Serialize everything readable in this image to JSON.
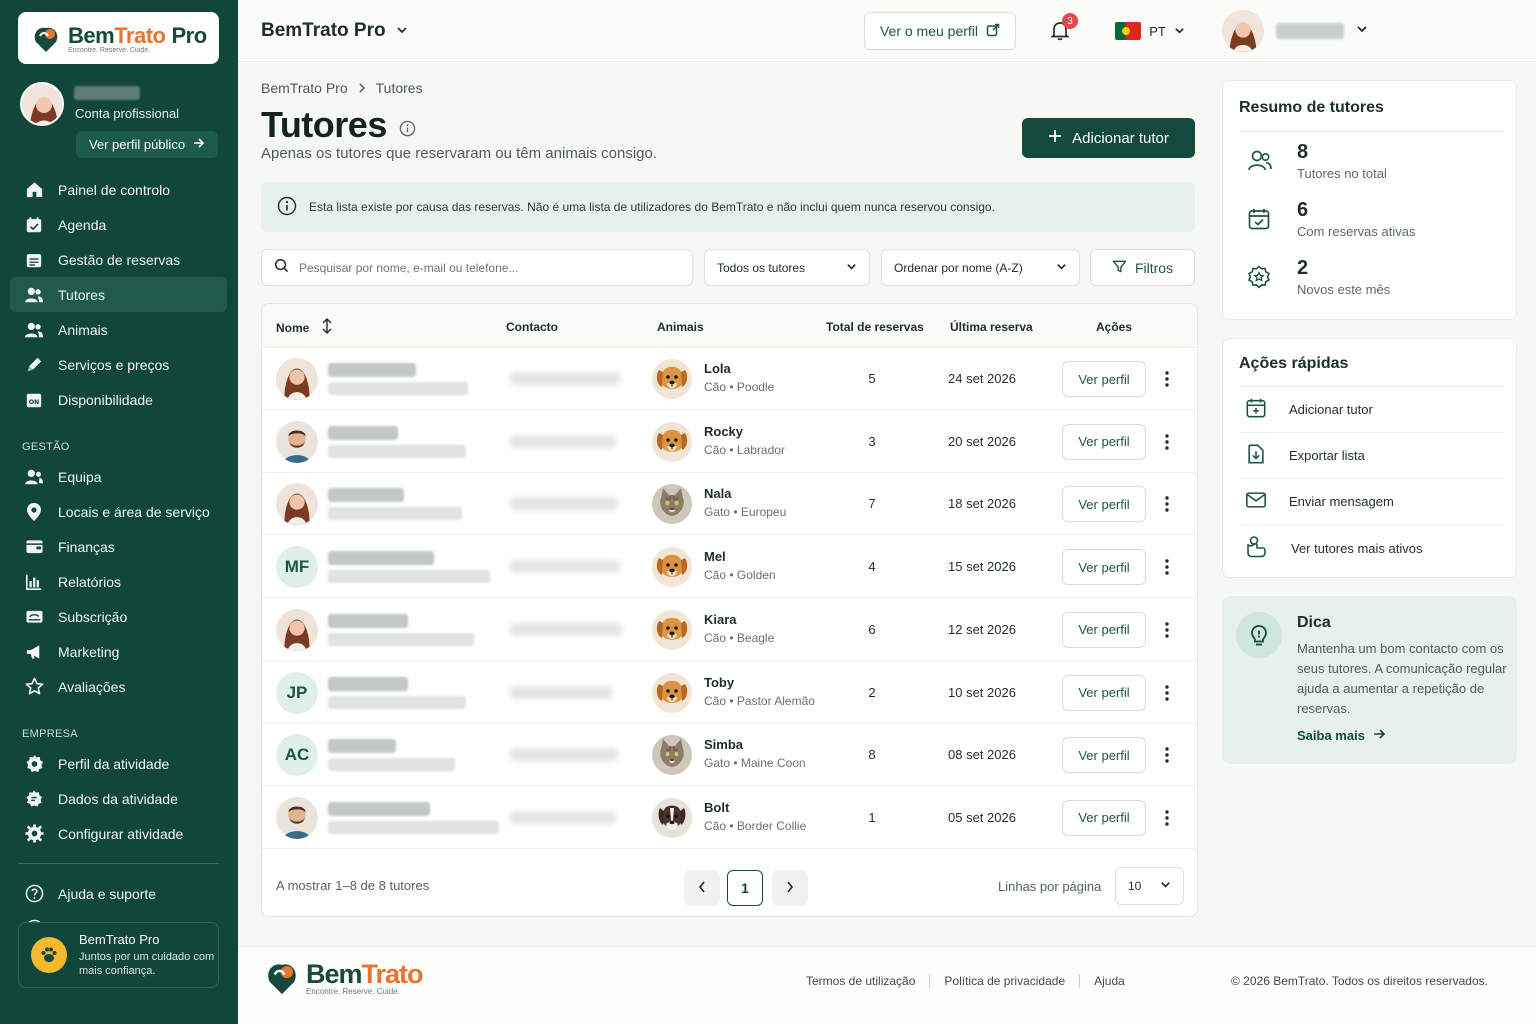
{
  "brand": {
    "name_part1": "Bem",
    "name_part2": "Trato",
    "suffix": "Pro",
    "tagline": "Encontre. Reserve. Cuide."
  },
  "sidebar": {
    "profile": {
      "role": "Conta profissional",
      "public_profile_label": "Ver perfil público"
    },
    "main_items": [
      {
        "label": "Painel de controlo",
        "icon": "home-icon"
      },
      {
        "label": "Agenda",
        "icon": "calendar-icon"
      },
      {
        "label": "Gestão de reservas",
        "icon": "calendar-list-icon"
      },
      {
        "label": "Tutores",
        "icon": "users-icon",
        "active": true
      },
      {
        "label": "Animais",
        "icon": "paw-users-icon"
      },
      {
        "label": "Serviços e preços",
        "icon": "tag-icon"
      },
      {
        "label": "Disponibilidade",
        "icon": "availability-icon"
      }
    ],
    "section_gestao": "GESTÃO",
    "gestao_items": [
      {
        "label": "Equipa",
        "icon": "team-icon"
      },
      {
        "label": "Locais e área de serviço",
        "icon": "location-icon"
      },
      {
        "label": "Finanças",
        "icon": "wallet-icon"
      },
      {
        "label": "Relatórios",
        "icon": "bar-chart-icon"
      },
      {
        "label": "Subscrição",
        "icon": "subscription-icon"
      },
      {
        "label": "Marketing",
        "icon": "megaphone-icon"
      },
      {
        "label": "Avaliações",
        "icon": "star-icon"
      }
    ],
    "section_empresa": "EMPRESA",
    "empresa_items": [
      {
        "label": "Perfil da atividade",
        "icon": "gear-badge-icon"
      },
      {
        "label": "Dados da atividade",
        "icon": "document-icon"
      },
      {
        "label": "Configurar atividade",
        "icon": "gear-icon"
      }
    ],
    "bottom_items": [
      {
        "label": "Ajuda e suporte",
        "icon": "help-icon"
      },
      {
        "label": "Conta",
        "icon": "account-icon"
      }
    ],
    "promo": {
      "title": "BemTrato Pro",
      "subtitle": "Juntos por um cuidado com mais confiança."
    }
  },
  "topbar": {
    "title": "BemTrato Pro",
    "profile_button": "Ver o meu perfil",
    "notifications_count": "3",
    "language": "PT"
  },
  "page": {
    "breadcrumb": [
      "BemTrato Pro",
      "Tutores"
    ],
    "title": "Tutores",
    "subtitle": "Apenas os tutores que reservaram ou têm animais consigo.",
    "add_button": "Adicionar tutor",
    "info": "Esta lista existe por causa das reservas. Não é uma lista de utilizadores do BemTrato e não inclui quem nunca reservou consigo.",
    "search_placeholder": "Pesquisar por nome, e-mail ou telefone...",
    "filter_select": "Todos os tutores",
    "sort_select": "Ordenar por nome (A-Z)",
    "filters_button": "Filtros"
  },
  "table": {
    "columns": {
      "name": "Nome",
      "contact": "Contacto",
      "animals": "Animais",
      "total": "Total de reservas",
      "last": "Última reserva",
      "actions": "Ações"
    },
    "view_label": "Ver perfil",
    "rows": [
      {
        "avatar": "photo-woman",
        "initials": "",
        "pet": "Lola",
        "species": "Cão",
        "breed": "Poodle",
        "pet_type": "dog",
        "total": "5",
        "last": "24 set 2026"
      },
      {
        "avatar": "photo-man",
        "initials": "",
        "pet": "Rocky",
        "species": "Cão",
        "breed": "Labrador",
        "pet_type": "dog",
        "total": "3",
        "last": "20 set 2026"
      },
      {
        "avatar": "photo-woman",
        "initials": "",
        "pet": "Nala",
        "species": "Gato",
        "breed": "Europeu",
        "pet_type": "cat",
        "total": "7",
        "last": "18 set 2026"
      },
      {
        "avatar": "initials",
        "initials": "MF",
        "pet": "Mel",
        "species": "Cão",
        "breed": "Golden",
        "pet_type": "dog",
        "total": "4",
        "last": "15 set 2026"
      },
      {
        "avatar": "photo-woman",
        "initials": "",
        "pet": "Kiara",
        "species": "Cão",
        "breed": "Beagle",
        "pet_type": "dog",
        "total": "6",
        "last": "12 set 2026"
      },
      {
        "avatar": "initials",
        "initials": "JP",
        "pet": "Toby",
        "species": "Cão",
        "breed": "Pastor Alemão",
        "pet_type": "dog",
        "total": "2",
        "last": "10 set 2026"
      },
      {
        "avatar": "initials",
        "initials": "AC",
        "pet": "Simba",
        "species": "Gato",
        "breed": "Maine Coon",
        "pet_type": "cat",
        "total": "8",
        "last": "08 set 2026"
      },
      {
        "avatar": "photo-man",
        "initials": "",
        "pet": "Bolt",
        "species": "Cão",
        "breed": "Border Collie",
        "pet_type": "collie",
        "total": "1",
        "last": "05 set 2026"
      }
    ],
    "showing": "A mostrar 1–8 de 8 tutores",
    "current_page": "1",
    "rows_per_page_label": "Linhas por página",
    "rows_per_page": "10"
  },
  "summary": {
    "title": "Resumo de tutores",
    "stats": [
      {
        "value": "8",
        "label": "Tutores no total",
        "icon": "users-icon"
      },
      {
        "value": "6",
        "label": "Com reservas ativas",
        "icon": "calendar-check-icon"
      },
      {
        "value": "2",
        "label": "Novos este mês",
        "icon": "star-badge-icon"
      }
    ]
  },
  "quick_actions": {
    "title": "Ações rápidas",
    "items": [
      {
        "label": "Adicionar tutor",
        "icon": "calendar-plus-icon"
      },
      {
        "label": "Exportar lista",
        "icon": "export-icon"
      },
      {
        "label": "Enviar mensagem",
        "icon": "mail-icon"
      },
      {
        "label": "Ver tutores mais ativos",
        "icon": "active-users-icon"
      }
    ]
  },
  "tip": {
    "title": "Dica",
    "text": "Mantenha um bom contacto com os seus tutores. A comunicação regular ajuda a aumentar a repetição de reservas.",
    "link": "Saiba mais"
  },
  "footer": {
    "links": [
      "Termos de utilização",
      "Política de privacidade",
      "Ajuda"
    ],
    "copyright": "© 2026 BemTrato. Todos os direitos reservados."
  },
  "colors": {
    "primary": "#11463a",
    "accent": "#134a3d",
    "info_bg": "#e6f1ec",
    "badge": "#e5484d"
  }
}
